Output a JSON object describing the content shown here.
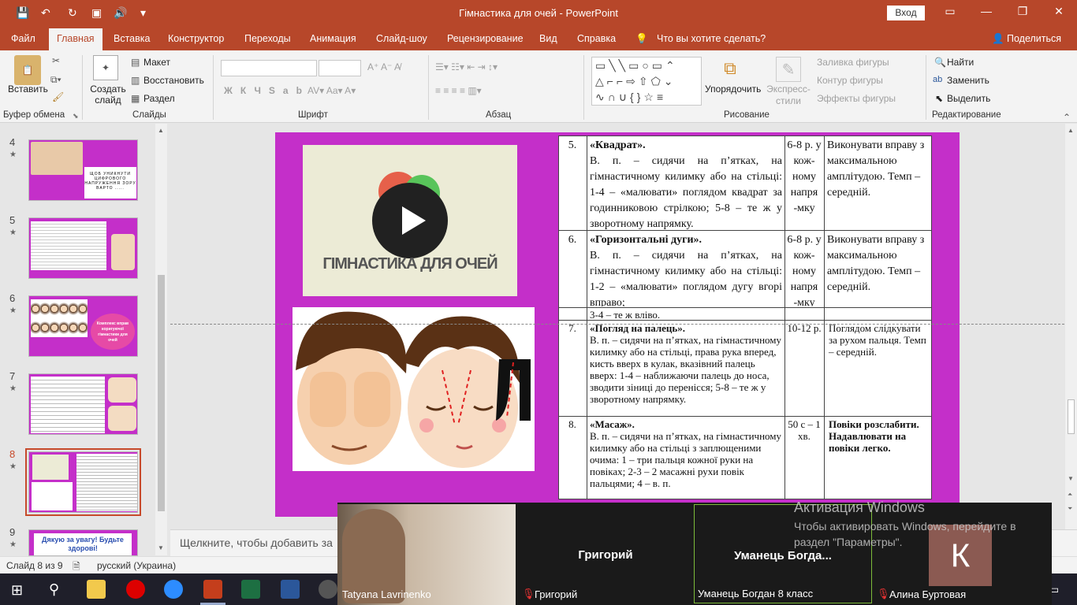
{
  "titlebar": {
    "title": "Гімнастика для очей  -  PowerPoint",
    "signin": "Вход"
  },
  "tabs": [
    "Файл",
    "Главная",
    "Вставка",
    "Конструктор",
    "Переходы",
    "Анимация",
    "Слайд-шоу",
    "Рецензирование",
    "Вид",
    "Справка",
    "Что вы хотите сделать?",
    "Поделиться"
  ],
  "ribbon": {
    "paste": "Вставить",
    "create_slide": "Создать слайд",
    "layout": "Макет",
    "reset": "Восстановить",
    "section": "Раздел",
    "arrange": "Упорядочить",
    "express_styles": "Экспресс-стили",
    "shape_fill": "Заливка фигуры",
    "shape_outline": "Контур фигуры",
    "shape_effects": "Эффекты фигуры",
    "find": "Найти",
    "replace": "Заменить",
    "select": "Выделить",
    "groups": {
      "clipboard": "Буфер обмена",
      "slides": "Слайды",
      "font": "Шрифт",
      "paragraph": "Абзац",
      "drawing": "Рисование",
      "editing": "Редактирование"
    }
  },
  "thumbnails": [
    {
      "num": "4",
      "text": "ЩОБ УНИКНУТИ ЦИФРОВОГО НАПРУЖЕННЯ ЗОРУ ВАРТО ....."
    },
    {
      "num": "5",
      "text": ""
    },
    {
      "num": "6",
      "text": "Комплекс вправ коригуючої гімнастики для очей"
    },
    {
      "num": "7",
      "text": ""
    },
    {
      "num": "8",
      "text": ""
    },
    {
      "num": "9",
      "text": "Дякую за увагу! Будьте здорові!"
    }
  ],
  "slide": {
    "video_caption": "ГІМНАСТИКА ДЛЯ ОЧЕЙ",
    "table_rows": [
      {
        "n": "5.",
        "title": "«Квадрат».",
        "body": "В. п. – сидячи на п’ятках, на гімнастичному килимку або на стільці: 1-4 – «малювати» поглядом квадрат за годинниковою стрілкою; 5-8 – те ж у зворотному напрямку.",
        "count": "6-8 р. у кож-ному напря -мку",
        "note": "Виконувати вправу з максимальною амплітудою. Темп – середній."
      },
      {
        "n": "6.",
        "title": "«Горизонтальні дуги».",
        "body": "В. п. – сидячи на п’ятках, на гімнастичному килимку або на стільці: 1-2 – «малювати» поглядом дугу вгорі вправо;",
        "count": "6-8 р. у кож-ному напря -мку",
        "note": "Виконувати вправу з максимальною амплітудою. Темп – середній."
      },
      {
        "n": "",
        "title": "",
        "body": "3-4 – те ж вліво.",
        "count": "",
        "note": ""
      },
      {
        "n": "7.",
        "title": "«Погляд на палець».",
        "body": "В. п. – сидячи на п’ятках, на гімнастичному килимку або на стільці, права рука вперед, кисть вверх в кулак, вказівний палець вверх: 1-4 – наближаючи палець до носа, зводити зіниці до перенісся; 5-8 – те ж у зворотному напрямку.",
        "count": "10-12 р.",
        "note": "Поглядом слідкувати за рухом пальця. Темп – середній."
      },
      {
        "n": "8.",
        "title": "«Масаж».",
        "body": "В. п. – сидячи на п’ятках, на гімнастичному килимку або на стільці з заплющеними очима: 1 – три пальця кожної руки на повіках; 2-3 – 2 масажні рухи повік пальцями; 4 – в. п.",
        "count": "50 с – 1 хв.",
        "note": "Повіки розслабити. Надавлювати на повіки легко."
      }
    ]
  },
  "notes_placeholder": "Щелкните, чтобы добавить за",
  "status": {
    "slide": "Слайд 8 из 9",
    "language": "русский (Украина)"
  },
  "zoom": {
    "participants": [
      {
        "label": "Tatyana Lavrinenko",
        "big": ""
      },
      {
        "label": "Григорий",
        "big": "Григорий"
      },
      {
        "label": "Уманець Богдан 8 класс",
        "big": "Уманець  Богда..."
      },
      {
        "label": "Алина Буртовая",
        "big": "К"
      }
    ]
  },
  "activation": {
    "title": "Активация Windows",
    "body": "Чтобы активировать Windows, перейдите в раздел \"Параметры\"."
  },
  "colors": {
    "accent": "#b7472a",
    "slide_bg": "#c42fc9"
  }
}
